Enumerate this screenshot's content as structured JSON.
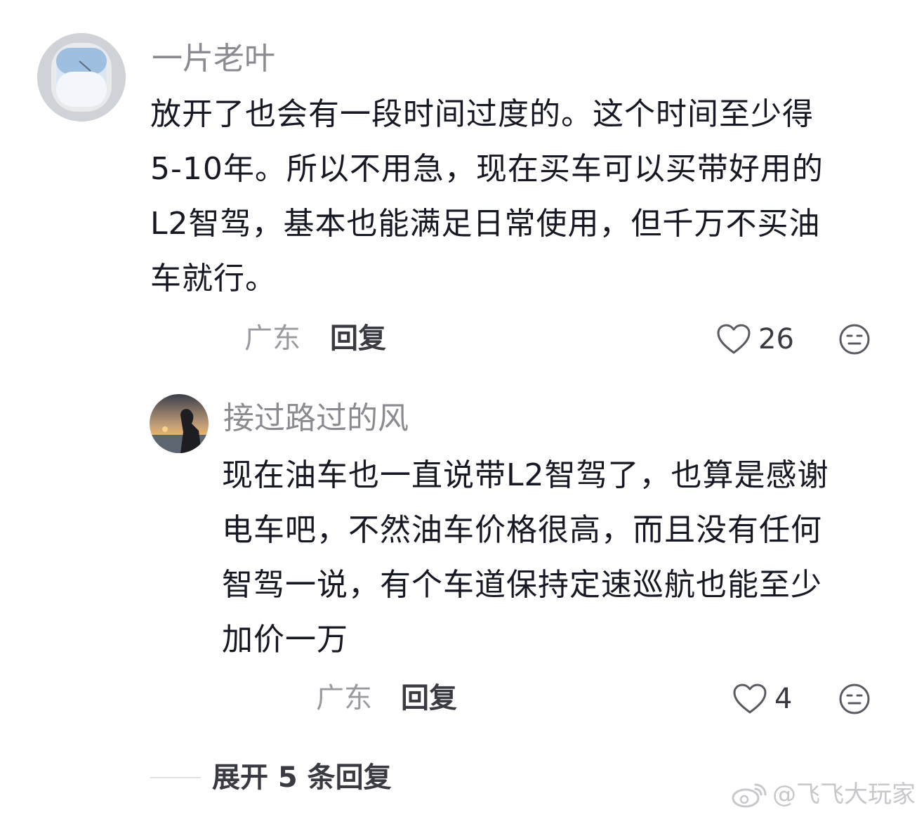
{
  "comments": [
    {
      "username": "一片老叶",
      "avatar": "airplane-window-avatar",
      "content_lines": [
        "放开了也会有一段时间过度的。这个时间至少得",
        "5-10年。所以不用急，现在买车可以买带好用的",
        "L2智驾，基本也能满足日常使用，但千万不买油",
        "车就行。"
      ],
      "location": "广东",
      "reply_label": "回复",
      "likes": "26"
    },
    {
      "username": "接过路过的风",
      "avatar": "sunset-beach-avatar",
      "content_lines": [
        "现在油车也一直说带L2智驾了，也算是感谢",
        "电车吧，不然油车价格很高，而且没有任何",
        "智驾一说，有个车道保持定速巡航也能至少",
        "加价一万"
      ],
      "location": "广东",
      "reply_label": "回复",
      "likes": "4"
    }
  ],
  "expand_replies": "展开 5 条回复",
  "watermark": "@飞飞大玩家",
  "colors": {
    "text": "#161823",
    "username": "#8a8b91",
    "meta": "#9a9ba1",
    "action": "#3a3b42"
  },
  "icons": [
    "heart-icon",
    "dislike-face-icon",
    "weibo-logo-icon"
  ]
}
